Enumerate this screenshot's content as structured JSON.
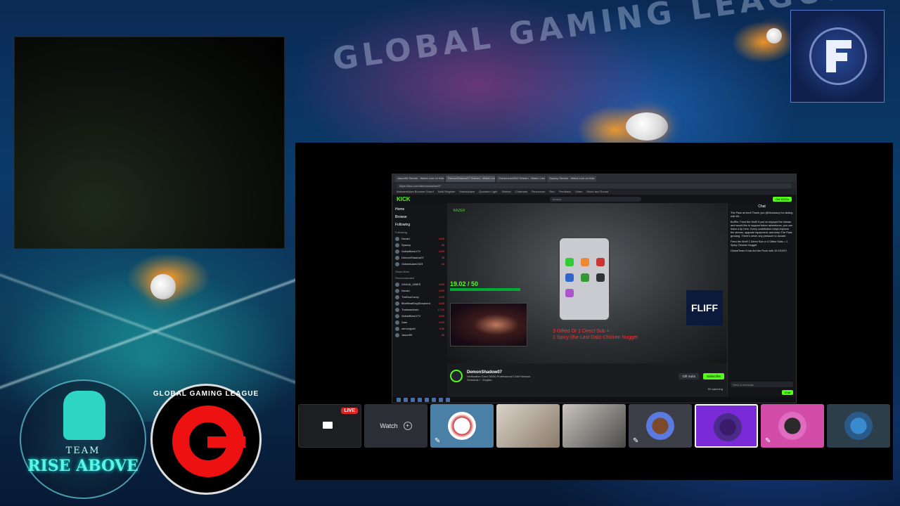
{
  "background": {
    "title": "GLOBAL GAMING LEAGUE"
  },
  "badges": {
    "team_line1": "TEAM",
    "team_line2": "RISE ABOVE",
    "ggl_ring": "GLOBAL GAMING LEAGUE"
  },
  "browser": {
    "tabs": [
      "Jason99 Stream - Watch Live on Kick",
      "DemonShadow07 Stream - Watch Live on Kick",
      "GuitarLudo2020 Stream - Watch Live on Kick",
      "Spazzy Stream - Watch Live on Kick"
    ],
    "url": "https://kick.com/demonshadow07",
    "bookmarks": [
      "Malwarebytes Browser Guard",
      "Multi-Register",
      "Marketplace",
      "Quantum Light",
      "Skinbet",
      "Chatmate",
      "Resources",
      "Rad",
      "Feedback",
      "Video",
      "Music and Sound"
    ],
    "kick_logo": "KICK",
    "search_placeholder": "Search",
    "get_button": "Get KICKs",
    "nav": [
      "Home",
      "Browse",
      "Following"
    ],
    "following_label": "Following",
    "following": [
      {
        "name": "Novad",
        "status": "LIVE"
      },
      {
        "name": "Spazzy",
        "status": "65"
      },
      {
        "name": "GuitarBrew17V",
        "status": "LIVE"
      },
      {
        "name": "DemonShadow07",
        "status": "38"
      },
      {
        "name": "GuitarAdam2323",
        "status": "45"
      }
    ],
    "show_more": "Show More",
    "recommended_label": "Recommended",
    "recommended": [
      {
        "name": "GANJA_VIBES",
        "status": "LIVE"
      },
      {
        "name": "Novad",
        "status": "LIVE"
      },
      {
        "name": "TheDocCorey",
        "status": "LIVE"
      },
      {
        "name": "BlueBeatDogShepherd",
        "status": "LIVE"
      },
      {
        "name": "Trainwreckstv",
        "status": "17.1K"
      },
      {
        "name": "GuitarBrew17V",
        "status": "LIVE"
      },
      {
        "name": "Sam",
        "status": "LIVE"
      },
      {
        "name": "zerocegold",
        "status": "4.0K"
      },
      {
        "name": "Jason99",
        "status": "54"
      }
    ],
    "video": {
      "hud_count": "19.02 / 50",
      "red_text_1": "3 Gifted Or 1 Direct Sub =",
      "red_text_2": "1 Spicy (the Last Dab) Chicken Nugget",
      "fliff": "FLIFF",
      "razer": "RAZER"
    },
    "streamer": {
      "name": "DemonShadow07",
      "title": "Verification Grind 50/50 Professional Child Session",
      "category": "Schedule I",
      "language": "English",
      "gift_button": "Gift Subs",
      "subscribe_button": "Subscribe",
      "watching": "50 watching"
    },
    "chat": {
      "header": "Chat",
      "messages": [
        "The Pack arrived! Thank you @Mocassey for raiding with 69...",
        "BotRix: Feed the Wolf! If you've enjoyed the stream and would like to support future adventures, you can leave a tip here. Every contribution helps improve the stream, upgrade equipment, and keep The Pack growing. There's never any pressure to donate.",
        "Feed the Wolf! 1 Direct Sub or 3 Gifted Subs = 1 Spicy Chicken Nugget",
        "GlobalTeam it has fed the Flock with 10 KICKS!"
      ],
      "input_placeholder": "Send a message",
      "send_button": "Chat"
    }
  },
  "strip": {
    "live_badge": "LIVE",
    "watch_label": "Watch",
    "tiles": [
      "self",
      "watch",
      "losanto",
      "cam1",
      "cam2",
      "avatar1",
      "avatar2",
      "avatar3",
      "avatar4"
    ]
  },
  "colors": {
    "kick_green": "#53fc18",
    "live_red": "#e02424",
    "tile_purple": "#7b2ad8",
    "tile_pink": "#d24ca8"
  }
}
